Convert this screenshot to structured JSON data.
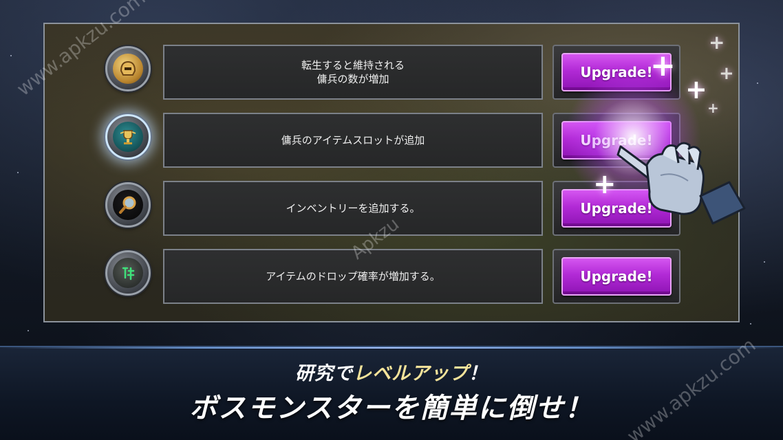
{
  "rows": [
    {
      "description_line1": "転生すると維持される",
      "description_line2": "傭兵の数が増加",
      "button": "Upgrade!",
      "icon": "golden-helmet-icon"
    },
    {
      "description_line1": "傭兵のアイテムスロットが追加",
      "description_line2": "",
      "button": "Upgrade!",
      "icon": "golden-trophy-icon"
    },
    {
      "description_line1": "インベントリーを追加する。",
      "description_line2": "",
      "button": "Upgrade!",
      "icon": "magnifier-icon"
    },
    {
      "description_line1": "アイテムのドロップ確率が増加する。",
      "description_line2": "",
      "button": "Upgrade!",
      "icon": "green-rune-icon"
    }
  ],
  "banner": {
    "line1_prefix": "研究で",
    "line1_highlight": "レベルアップ",
    "line1_suffix": "！",
    "line2": "ボスモンスターを簡単に倒せ！"
  },
  "watermarks": {
    "top_left": "www.apkzu.com",
    "center": "Apkzu",
    "bottom_right": "www.apkzu.com"
  },
  "colors": {
    "button_purple": "#b22ad6",
    "highlight_yellow": "#f4e39a",
    "panel_border": "#8c939c"
  }
}
